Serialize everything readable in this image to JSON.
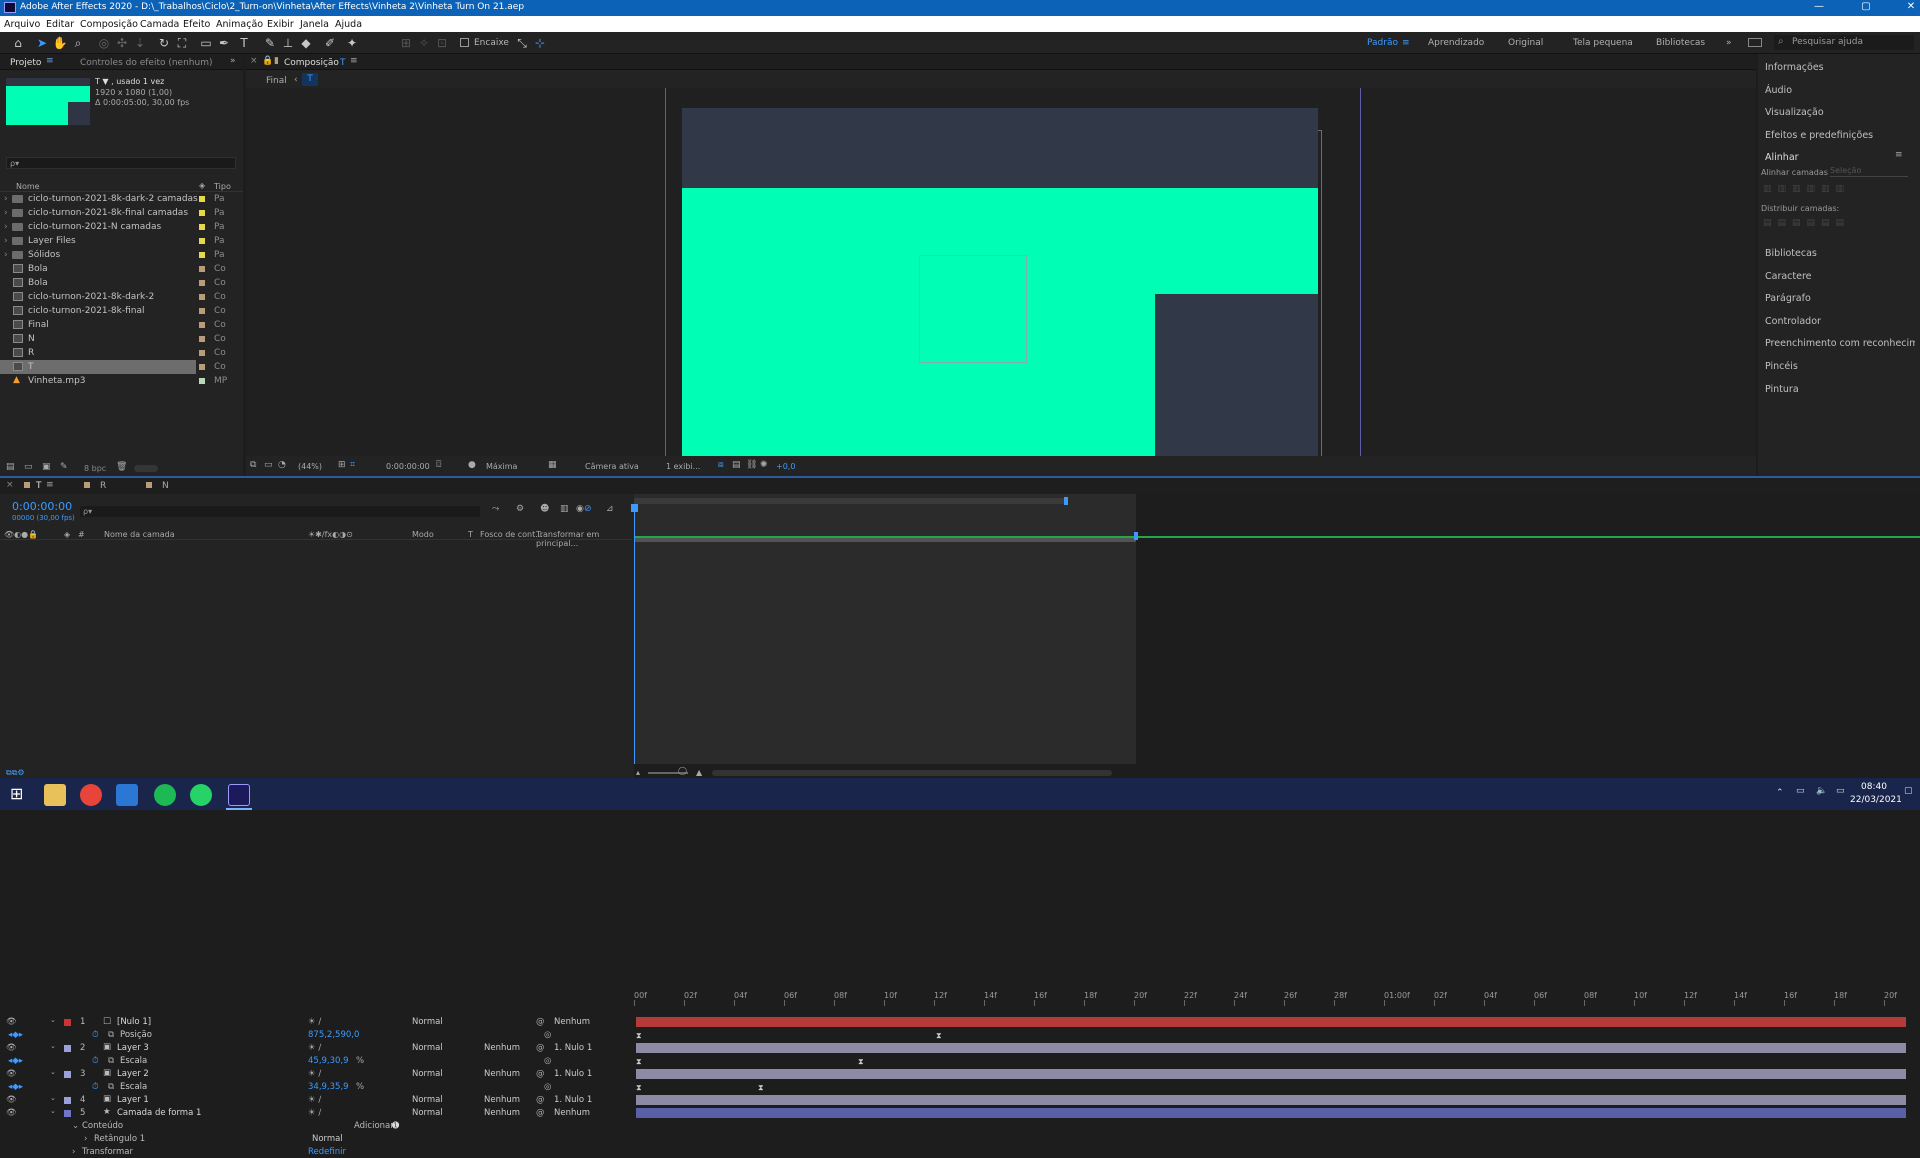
{
  "window": {
    "title": "Adobe After Effects 2020 - D:\\_Trabalhos\\Ciclo\\2_Turn-on\\Vinheta\\After Effects\\Vinheta 2\\Vinheta Turn On 21.aep",
    "min": "—",
    "max": "▢",
    "close": "✕"
  },
  "menu": [
    "Arquivo",
    "Editar",
    "Composição",
    "Camada",
    "Efeito",
    "Animação",
    "Exibir",
    "Janela",
    "Ajuda"
  ],
  "toolbar": {
    "encaixe": "Encaixe",
    "workspaces": [
      "Padrão",
      "Aprendizado",
      "Original",
      "Tela pequena",
      "Bibliotecas"
    ],
    "search_placeholder": "Pesquisar ajuda"
  },
  "project_panel": {
    "tab_project": "Projeto",
    "tab_effects": "Controles do efeito  (nenhum)",
    "item_name": "T ▼ , usado 1 vez",
    "item_dims": "1920 x 1080 (1,00)",
    "item_dur": "Δ 0:00:05:00, 30,00 fps",
    "search_placeholder": "ρ▾",
    "col_name": "Nome",
    "col_type": "Tipo",
    "bpc": "8 bpc",
    "items": [
      {
        "name": "ciclo-turnon-2021-8k-dark-2 camadas",
        "kind": "folder",
        "color": "#e4d84c",
        "type": "Pa"
      },
      {
        "name": "ciclo-turnon-2021-8k-final camadas",
        "kind": "folder",
        "color": "#e4d84c",
        "type": "Pa"
      },
      {
        "name": "ciclo-turnon-2021-N camadas",
        "kind": "folder",
        "color": "#e4d84c",
        "type": "Pa"
      },
      {
        "name": "Layer Files",
        "kind": "folder",
        "color": "#e4d84c",
        "type": "Pa"
      },
      {
        "name": "Sólidos",
        "kind": "folder",
        "color": "#e4d84c",
        "type": "Pa"
      },
      {
        "name": "Bola",
        "kind": "comp",
        "color": "#b99c7a",
        "type": "Co"
      },
      {
        "name": "Bola",
        "kind": "comp",
        "color": "#b99c7a",
        "type": "Co"
      },
      {
        "name": "ciclo-turnon-2021-8k-dark-2",
        "kind": "comp",
        "color": "#b99c7a",
        "type": "Co"
      },
      {
        "name": "ciclo-turnon-2021-8k-final",
        "kind": "comp",
        "color": "#b99c7a",
        "type": "Co"
      },
      {
        "name": "Final",
        "kind": "comp",
        "color": "#b99c7a",
        "type": "Co"
      },
      {
        "name": "N",
        "kind": "comp",
        "color": "#b99c7a",
        "type": "Co"
      },
      {
        "name": "R",
        "kind": "comp",
        "color": "#b99c7a",
        "type": "Co"
      },
      {
        "name": "T",
        "kind": "comp",
        "color": "#b99c7a",
        "type": "Co",
        "selected": true
      },
      {
        "name": "Vinheta.mp3",
        "kind": "audio",
        "color": "#b8d8b8",
        "type": "MP"
      }
    ]
  },
  "comp_panel": {
    "tab": "Composição",
    "tab_name": "T",
    "crumbs": [
      "Final",
      "T"
    ],
    "zoom": "(44%)",
    "timecode": "0:00:00:00",
    "resolution": "Máxima",
    "camera": "Câmera ativa",
    "views": "1 exibi...",
    "exposure": "+0,0"
  },
  "right_panel": {
    "items_top": [
      "Informações",
      "Áudio",
      "Visualização",
      "Efeitos e predefinições"
    ],
    "align": "Alinhar",
    "align_layers": "Alinhar camadas",
    "align_to": "Seleção",
    "distribute": "Distribuir camadas:",
    "items_bottom": [
      "Bibliotecas",
      "Caractere",
      "Parágrafo",
      "Controlador",
      "Preenchimento com reconhecimento d",
      "Pincéis",
      "Pintura"
    ]
  },
  "timeline": {
    "tabs": [
      {
        "label": "T",
        "color": "#b99c7a"
      },
      {
        "label": "R",
        "color": "#b99c7a"
      },
      {
        "label": "N",
        "color": "#b99c7a"
      }
    ],
    "timecode": "0:00:00:00",
    "fps": "00000 (30,00 fps)",
    "search_placeholder": "ρ▾",
    "col_name": "Nome da camada",
    "col_mode": "Modo",
    "col_t": "T",
    "col_track": "Fosco de cont...",
    "col_parent": "Transformar em principal...",
    "ruler": [
      "00f",
      "02f",
      "04f",
      "06f",
      "08f",
      "10f",
      "12f",
      "14f",
      "16f",
      "18f",
      "20f",
      "22f",
      "24f",
      "26f",
      "28f",
      "01:00f",
      "02f",
      "04f",
      "06f",
      "08f",
      "10f",
      "12f",
      "14f",
      "16f",
      "18f",
      "20f"
    ],
    "layers": [
      {
        "num": "1",
        "name": "[Nulo 1]",
        "color": "#c33",
        "mode": "Normal",
        "track": "",
        "parent": "Nenhum",
        "bar": "#b53a3a"
      },
      {
        "prop": "Posição",
        "value": "875,2,590,0"
      },
      {
        "num": "2",
        "name": "Layer 3",
        "color": "#9aa0d8",
        "mode": "Normal",
        "track": "Nenhum",
        "parent": "1. Nulo 1",
        "bar": "#8d8aa6"
      },
      {
        "prop": "Escala",
        "value": "45,9,30,9",
        "unit": "%"
      },
      {
        "num": "3",
        "name": "Layer 2",
        "color": "#9aa0d8",
        "mode": "Normal",
        "track": "Nenhum",
        "parent": "1. Nulo 1",
        "bar": "#8d8aa6"
      },
      {
        "prop": "Escala",
        "value": "34,9,35,9",
        "unit": "%"
      },
      {
        "num": "4",
        "name": "Layer 1",
        "color": "#9aa0d8",
        "mode": "Normal",
        "track": "Nenhum",
        "parent": "1. Nulo 1",
        "bar": "#8d8aa6"
      },
      {
        "num": "5",
        "name": "Camada de forma 1",
        "color": "#6f76c8",
        "mode": "Normal",
        "track": "Nenhum",
        "parent": "Nenhum",
        "bar": "#5960a8"
      }
    ],
    "content": "Conteúdo",
    "add": "Adicionar:",
    "rect": "Retângulo 1",
    "rect_mode": "Normal",
    "transform": "Transformar",
    "reset": "Redefinir"
  },
  "taskbar": {
    "time": "08:40",
    "date": "22/03/2021"
  },
  "colors": {
    "accent": "#2d8ceb",
    "comp_bg": "#313848",
    "comp_green": "#00ffb4"
  }
}
